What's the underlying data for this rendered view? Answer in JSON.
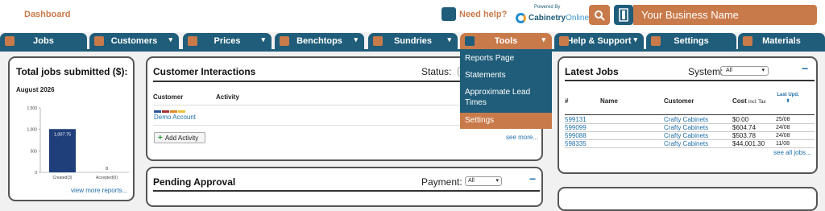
{
  "header": {
    "title": "Dashboard",
    "need_help": "Need help?",
    "powered_by": "Powered By",
    "logo_main": "Cabinetry",
    "logo_suffix": "Online",
    "business_name": "Your Business Name (Cabinetry.Online)"
  },
  "nav": {
    "tabs": [
      {
        "label": "Jobs"
      },
      {
        "label": "Customers"
      },
      {
        "label": "Prices"
      },
      {
        "label": "Benchtops"
      },
      {
        "label": "Sundries"
      },
      {
        "label": "Tools"
      },
      {
        "label": "Help & Support"
      },
      {
        "label": "Settings"
      },
      {
        "label": "Materials"
      }
    ],
    "tools_menu": [
      "Reports Page",
      "Statements",
      "Approximate Lead Times",
      "Settings"
    ]
  },
  "total_jobs": {
    "title": "Total jobs submitted ($):",
    "month": "August 2026",
    "view_more": "view more reports...",
    "chart_data": {
      "type": "bar",
      "categories": [
        "Created(3)",
        "Accepted(0)"
      ],
      "values": [
        1007.75,
        0
      ],
      "data_labels": [
        "1,007.75",
        "0"
      ],
      "ylim": [
        0,
        1500
      ],
      "yticks": [
        0,
        500,
        1000,
        1500
      ],
      "ytick_labels": [
        "0",
        "500",
        "1,000",
        "1,500"
      ],
      "grid": false
    }
  },
  "customer_interactions": {
    "title": "Customer Interactions",
    "status_label": "Status:",
    "col_customer": "Customer",
    "col_activity": "Activity",
    "customer": "Demo Account",
    "strip_colors": [
      "#2a5599",
      "#a83232",
      "#e08a2a",
      "#e8c23a"
    ],
    "add_activity": "Add Activity",
    "see_more": "see more..."
  },
  "pending": {
    "title": "Pending Approval",
    "payment_label": "Payment:",
    "payment_value": "All"
  },
  "latest_jobs": {
    "title": "Latest Jobs",
    "system_label": "System:",
    "system_value": "All",
    "col_num": "#",
    "col_name": "Name",
    "col_customer": "Customer",
    "col_cost": "Cost",
    "col_cost_note": "incl. Tax",
    "col_last_line1": "Last Upd.",
    "col_last_line2": "⬍",
    "rows": [
      {
        "num": "599131",
        "customer": "Crafty Cabinets",
        "cost": "$0.00",
        "date": "25/08"
      },
      {
        "num": "599099",
        "customer": "Crafty Cabinets",
        "cost": "$604.74",
        "date": "24/08"
      },
      {
        "num": "599088",
        "customer": "Crafty Cabinets",
        "cost": "$503.78",
        "date": "24/08"
      },
      {
        "num": "598335",
        "customer": "Crafty Cabinets",
        "cost": "$44,001.30",
        "date": "11/08"
      }
    ],
    "see_all": "see all jobs..."
  },
  "colors": {
    "primary": "#1f5d7a",
    "accent": "#c97a4a",
    "link": "#1f6fa8"
  }
}
